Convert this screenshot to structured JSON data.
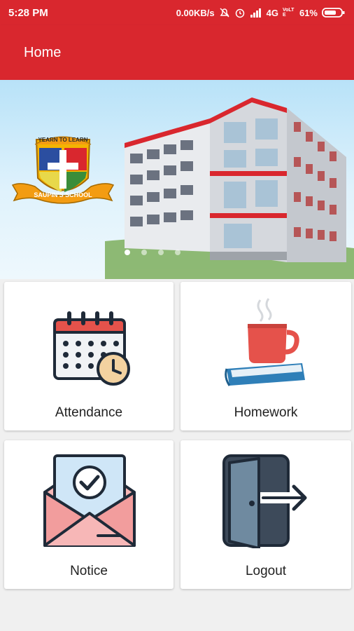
{
  "status_bar": {
    "time": "5:28 PM",
    "network_speed": "0.00KB/s",
    "signal": "4G",
    "volte": "VoLTE",
    "battery": "61%"
  },
  "app_bar": {
    "title": "Home"
  },
  "banner": {
    "logo_text_top": "YEARN TO LEARN",
    "logo_text_bottom": "SAUPIN'S SCHOOL",
    "slide_count": 4,
    "active_slide": 1
  },
  "menu": [
    {
      "label": "Attendance",
      "icon": "calendar-clock-icon"
    },
    {
      "label": "Homework",
      "icon": "mug-book-icon"
    },
    {
      "label": "Notice",
      "icon": "envelope-check-icon"
    },
    {
      "label": "Logout",
      "icon": "door-exit-icon"
    }
  ],
  "colors": {
    "primary": "#d9272e",
    "background": "#f0f0f0",
    "tile": "#ffffff"
  }
}
